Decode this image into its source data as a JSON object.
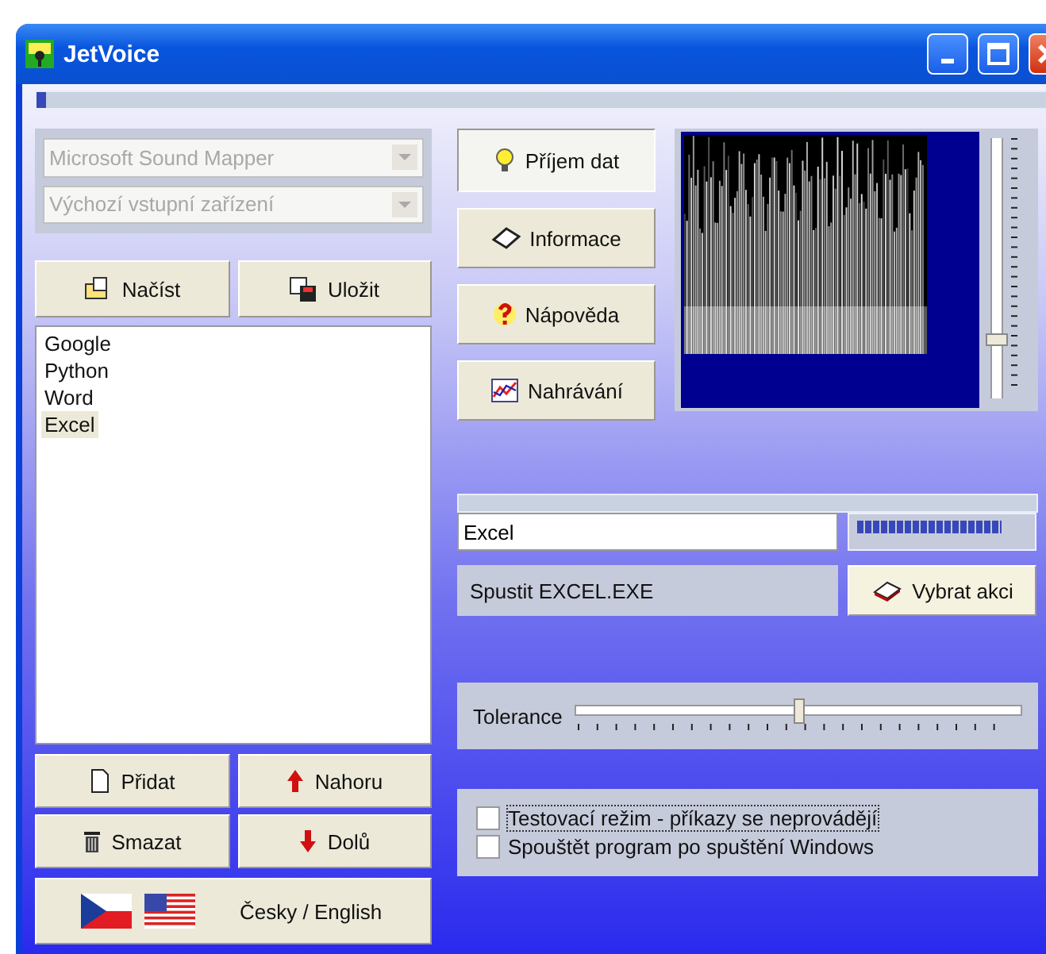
{
  "window": {
    "title": "JetVoice"
  },
  "top_progress": {
    "level": 0.01
  },
  "device_selects": [
    {
      "value": "Microsoft Sound Mapper",
      "disabled": true
    },
    {
      "value": "Výchozí vstupní zařízení",
      "disabled": true
    }
  ],
  "file_buttons": [
    {
      "label": "Načíst",
      "kind": "open"
    },
    {
      "label": "Uložit",
      "kind": "save"
    }
  ],
  "list": [
    {
      "label": "Google",
      "selected": false
    },
    {
      "label": "Python",
      "selected": false
    },
    {
      "label": "Word",
      "selected": false
    },
    {
      "label": "Excel",
      "selected": true
    }
  ],
  "edit_buttons": [
    {
      "label": "Přidat",
      "kind": "add"
    },
    {
      "label": "Nahoru",
      "kind": "up"
    },
    {
      "label": "Smazat",
      "kind": "delete"
    },
    {
      "label": "Dolů",
      "kind": "down"
    }
  ],
  "language_button": {
    "label": "Česky / English"
  },
  "nav_buttons": [
    {
      "label": "Příjem dat",
      "kind": "bulb",
      "pressed": true
    },
    {
      "label": "Informace",
      "kind": "info",
      "pressed": false
    },
    {
      "label": "Nápověda",
      "kind": "help",
      "pressed": false
    },
    {
      "label": "Nahrávání",
      "kind": "chart",
      "pressed": false
    }
  ],
  "spectrogram_slider": {
    "level": 0.2
  },
  "command_field": {
    "value": "Excel"
  },
  "level_meter": {
    "level": 0.85
  },
  "action_text": "Spustit EXCEL.EXE",
  "action_button": {
    "label": "Vybrat akci"
  },
  "tolerance": {
    "label": "Tolerance",
    "level": 0.5
  },
  "options": [
    {
      "label": "Testovací režim - příkazy se neprovádějí",
      "checked": false
    },
    {
      "label": "Spouštět program po spuštění Windows",
      "checked": false
    }
  ]
}
